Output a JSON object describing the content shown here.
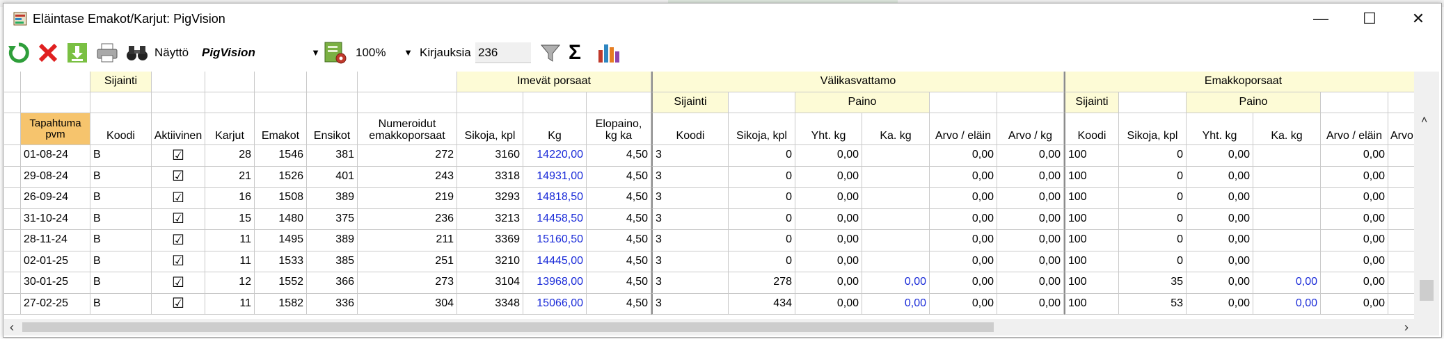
{
  "window": {
    "title": "Eläintase Emakot/Karjut: PigVision",
    "minimize_glyph": "—",
    "maximize_glyph": "☐",
    "close_glyph": "✕"
  },
  "toolbar": {
    "icons": [
      "refresh-icon",
      "delete-icon",
      "download-icon",
      "print-icon",
      "binoculars-icon",
      "view-settings-icon",
      "filter-icon",
      "sum-icon",
      "chart-icon"
    ],
    "naytto_label": "Näyttö",
    "view_value": "PigVision",
    "zoom_value": "100%",
    "kirjauksia_label": "Kirjauksia",
    "kirjauksia_value": "236"
  },
  "grid": {
    "groups": {
      "sijainti": "Sijainti",
      "imevat": "Imevät porsaat",
      "valikasvattamo": "Välikasvattamo",
      "emakkoporsaat": "Emakkoporsaat",
      "sub_sijainti": "Sijainti",
      "sub_paino": "Paino"
    },
    "columns": {
      "date": "Tapahtuma pvm",
      "koodi": "Koodi",
      "aktiivinen": "Aktiivinen",
      "karjut": "Karjut",
      "emakot": "Emakot",
      "ensikot": "Ensikot",
      "numeroidut": "Numeroidut emakkoporsaat",
      "sikoja": "Sikoja, kpl",
      "kg": "Kg",
      "elopaino": "Elopaino, kg ka",
      "yht_kg": "Yht. kg",
      "ka_kg": "Ka. kg",
      "arvo_elain": "Arvo / eläin",
      "arvo_kg": "Arvo / kg",
      "arvo_partial": "Arvo"
    },
    "rows": [
      {
        "date": "01-08-24",
        "koodi": "B",
        "aktiivinen": "☑",
        "karjut": "28",
        "emakot": "1546",
        "ensikot": "381",
        "numeroidut": "272",
        "imevat_sikoja": "3160",
        "imevat_kg": "14220,00",
        "elopaino": "4,50",
        "v_koodi": "3",
        "v_sikoja": "0",
        "v_yht": "0,00",
        "v_ka": "",
        "v_arvo_elain": "0,00",
        "v_arvo_kg": "0,00",
        "e_koodi": "100",
        "e_sikoja": "0",
        "e_yht": "0,00",
        "e_ka": "",
        "e_arvo_elain": "0,00"
      },
      {
        "date": "29-08-24",
        "koodi": "B",
        "aktiivinen": "☑",
        "karjut": "21",
        "emakot": "1526",
        "ensikot": "401",
        "numeroidut": "243",
        "imevat_sikoja": "3318",
        "imevat_kg": "14931,00",
        "elopaino": "4,50",
        "v_koodi": "3",
        "v_sikoja": "0",
        "v_yht": "0,00",
        "v_ka": "",
        "v_arvo_elain": "0,00",
        "v_arvo_kg": "0,00",
        "e_koodi": "100",
        "e_sikoja": "0",
        "e_yht": "0,00",
        "e_ka": "",
        "e_arvo_elain": "0,00"
      },
      {
        "date": "26-09-24",
        "koodi": "B",
        "aktiivinen": "☑",
        "karjut": "16",
        "emakot": "1508",
        "ensikot": "389",
        "numeroidut": "219",
        "imevat_sikoja": "3293",
        "imevat_kg": "14818,50",
        "elopaino": "4,50",
        "v_koodi": "3",
        "v_sikoja": "0",
        "v_yht": "0,00",
        "v_ka": "",
        "v_arvo_elain": "0,00",
        "v_arvo_kg": "0,00",
        "e_koodi": "100",
        "e_sikoja": "0",
        "e_yht": "0,00",
        "e_ka": "",
        "e_arvo_elain": "0,00"
      },
      {
        "date": "31-10-24",
        "koodi": "B",
        "aktiivinen": "☑",
        "karjut": "15",
        "emakot": "1480",
        "ensikot": "375",
        "numeroidut": "236",
        "imevat_sikoja": "3213",
        "imevat_kg": "14458,50",
        "elopaino": "4,50",
        "v_koodi": "3",
        "v_sikoja": "0",
        "v_yht": "0,00",
        "v_ka": "",
        "v_arvo_elain": "0,00",
        "v_arvo_kg": "0,00",
        "e_koodi": "100",
        "e_sikoja": "0",
        "e_yht": "0,00",
        "e_ka": "",
        "e_arvo_elain": "0,00"
      },
      {
        "date": "28-11-24",
        "koodi": "B",
        "aktiivinen": "☑",
        "karjut": "11",
        "emakot": "1495",
        "ensikot": "389",
        "numeroidut": "211",
        "imevat_sikoja": "3369",
        "imevat_kg": "15160,50",
        "elopaino": "4,50",
        "v_koodi": "3",
        "v_sikoja": "0",
        "v_yht": "0,00",
        "v_ka": "",
        "v_arvo_elain": "0,00",
        "v_arvo_kg": "0,00",
        "e_koodi": "100",
        "e_sikoja": "0",
        "e_yht": "0,00",
        "e_ka": "",
        "e_arvo_elain": "0,00"
      },
      {
        "date": "02-01-25",
        "koodi": "B",
        "aktiivinen": "☑",
        "karjut": "11",
        "emakot": "1533",
        "ensikot": "385",
        "numeroidut": "251",
        "imevat_sikoja": "3210",
        "imevat_kg": "14445,00",
        "elopaino": "4,50",
        "v_koodi": "3",
        "v_sikoja": "0",
        "v_yht": "0,00",
        "v_ka": "",
        "v_arvo_elain": "0,00",
        "v_arvo_kg": "0,00",
        "e_koodi": "100",
        "e_sikoja": "0",
        "e_yht": "0,00",
        "e_ka": "",
        "e_arvo_elain": "0,00"
      },
      {
        "date": "30-01-25",
        "koodi": "B",
        "aktiivinen": "☑",
        "karjut": "12",
        "emakot": "1552",
        "ensikot": "366",
        "numeroidut": "273",
        "imevat_sikoja": "3104",
        "imevat_kg": "13968,00",
        "elopaino": "4,50",
        "v_koodi": "3",
        "v_sikoja": "278",
        "v_yht": "0,00",
        "v_ka": "0,00",
        "v_arvo_elain": "0,00",
        "v_arvo_kg": "0,00",
        "e_koodi": "100",
        "e_sikoja": "35",
        "e_yht": "0,00",
        "e_ka": "0,00",
        "e_arvo_elain": "0,00"
      },
      {
        "date": "27-02-25",
        "koodi": "B",
        "aktiivinen": "☑",
        "karjut": "11",
        "emakot": "1582",
        "ensikot": "336",
        "numeroidut": "304",
        "imevat_sikoja": "3348",
        "imevat_kg": "15066,00",
        "elopaino": "4,50",
        "v_koodi": "3",
        "v_sikoja": "434",
        "v_yht": "0,00",
        "v_ka": "0,00",
        "v_arvo_elain": "0,00",
        "v_arvo_kg": "0,00",
        "e_koodi": "100",
        "e_sikoja": "53",
        "e_yht": "0,00",
        "e_ka": "0,00",
        "e_arvo_elain": "0,00"
      }
    ]
  },
  "colors": {
    "header_yellow": "#fdfbd6",
    "sort_header_orange": "#f6c46d",
    "link_blue": "#1a2bd8"
  },
  "scrollbar": {
    "left_glyph": "‹",
    "right_glyph": "›",
    "up_glyph": "˄"
  }
}
